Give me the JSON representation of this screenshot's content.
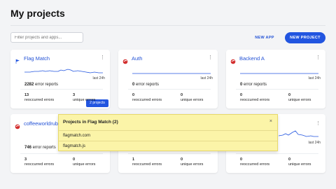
{
  "page": {
    "title": "My projects"
  },
  "toolbar": {
    "search_placeholder": "Filter projects and apps...",
    "new_app_label": "NEW APP",
    "new_project_label": "NEW PROJECT"
  },
  "colors": {
    "accent": "#2255e0",
    "logo_red": "#d22c2c",
    "popover_bg": "#fbf4a8"
  },
  "cards": [
    {
      "name": "Flag Match",
      "icon": "flag-icon",
      "range": "last 24h",
      "reports": "2282",
      "reports_label": " error reports",
      "reoccurred": "13",
      "reoccurred_label": "reoccurred errors",
      "unique": "3",
      "unique_label": "unique errors",
      "badge": "2 projects"
    },
    {
      "name": "Auth",
      "icon": "swirl-logo-icon",
      "range": "last 24h",
      "reports": "0",
      "reports_label": " error reports",
      "reoccurred": "0",
      "reoccurred_label": "reoccurred errors",
      "unique": "0",
      "unique_label": "unique errors"
    },
    {
      "name": "Backend A",
      "icon": "swirl-logo-icon",
      "range": "last 24h",
      "reports": "0",
      "reports_label": " error reports",
      "reoccurred": "0",
      "reoccurred_label": "reoccurred errors",
      "unique": "0",
      "unique_label": "unique errors"
    },
    {
      "name": "coffeeworldruby",
      "icon": "swirl-logo-icon",
      "range": "last 24h",
      "reports": "746",
      "reports_label": " error reports",
      "reoccurred": "3",
      "reoccurred_label": "reoccurred errors",
      "unique": "0",
      "unique_label": "unique errors"
    },
    {
      "name": "",
      "icon": "swirl-logo-icon",
      "range": "",
      "reports": "",
      "reports_label": "",
      "reoccurred": "1",
      "reoccurred_label": "reoccurred errors",
      "unique": "0",
      "unique_label": "unique errors"
    },
    {
      "name": "",
      "icon": "swirl-logo-icon",
      "range": "last 24h",
      "reports": "",
      "reports_label": "",
      "reoccurred": "0",
      "reoccurred_label": "reoccurred errors",
      "unique": "0",
      "unique_label": "unique errors"
    }
  ],
  "popover": {
    "title": "Projects in Flag Match (2)",
    "close": "×",
    "items": [
      "flagmatch.com",
      "flagmatch.js"
    ]
  }
}
